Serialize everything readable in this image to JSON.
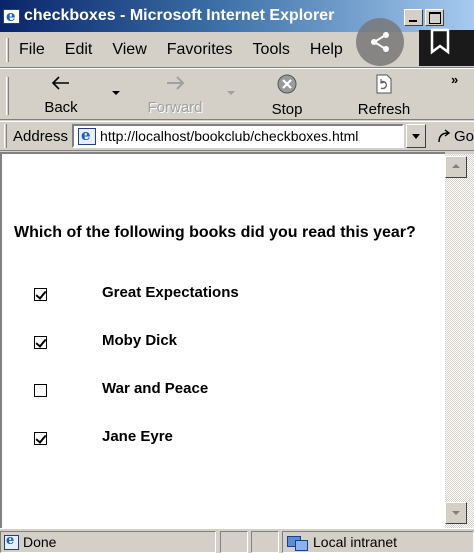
{
  "window": {
    "title": "checkboxes - Microsoft Internet Explorer",
    "title_icon_glyph": "e"
  },
  "menu": [
    "File",
    "Edit",
    "View",
    "Favorites",
    "Tools",
    "Help"
  ],
  "toolbar": {
    "back_label": "Back",
    "forward_label": "Forward",
    "stop_label": "Stop",
    "refresh_label": "Refresh",
    "more_glyph": "»"
  },
  "address": {
    "label": "Address",
    "url": "http://localhost/bookclub/checkboxes.html",
    "go_label": "Go"
  },
  "page": {
    "question": "Which of the following books did you read this year?",
    "options": [
      {
        "label": "Great Expectations",
        "checked": true
      },
      {
        "label": "Moby Dick",
        "checked": true
      },
      {
        "label": "War and Peace",
        "checked": false
      },
      {
        "label": "Jane Eyre",
        "checked": true
      }
    ]
  },
  "status": {
    "text": "Done",
    "zone": "Local intranet"
  },
  "colors": {
    "titlebar_start": "#0a246a",
    "titlebar_end": "#a6caf0",
    "chrome": "#d4d0c8"
  },
  "icons": {
    "title": "ie-logo-icon",
    "back": "back-arrow-icon",
    "forward": "forward-arrow-icon",
    "stop": "stop-icon",
    "refresh": "refresh-icon",
    "share": "share-icon",
    "bookmark": "bookmark-icon",
    "zone": "intranet-zone-icon"
  }
}
